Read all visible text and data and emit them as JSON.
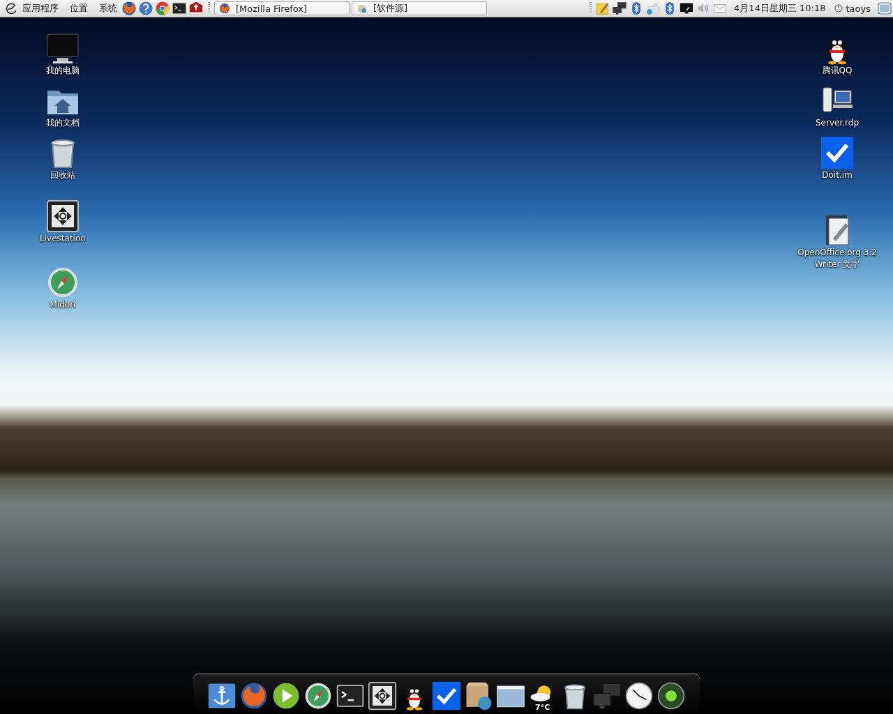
{
  "top_panel": {
    "menus": [
      "应用程序",
      "位置",
      "系统"
    ],
    "launchers": [
      {
        "kind": "firefox"
      },
      {
        "kind": "help"
      },
      {
        "kind": "chrome"
      },
      {
        "kind": "terminal"
      },
      {
        "kind": "book"
      }
    ],
    "window_buttons": [
      {
        "title": "[Mozilla Firefox]",
        "kind": "firefox"
      },
      {
        "title": "[软件源]",
        "kind": "software"
      }
    ],
    "tray": [
      {
        "kind": "notes"
      },
      {
        "kind": "network"
      },
      {
        "kind": "bluetooth"
      },
      {
        "kind": "keyboard"
      },
      {
        "kind": "bluetooth"
      },
      {
        "kind": "monitor"
      },
      {
        "kind": "volume"
      },
      {
        "kind": "mail"
      }
    ],
    "clock": "4月14日星期三 10:18",
    "user": "taoys"
  },
  "desktop_left": [
    {
      "label": "我的电脑",
      "kind": "computer"
    },
    {
      "label": "我的文档",
      "kind": "home"
    },
    {
      "label": "回收站",
      "kind": "trash"
    },
    {
      "label": "Livestation",
      "kind": "move"
    },
    {
      "label": "Midori",
      "kind": "compass"
    }
  ],
  "desktop_right": [
    {
      "label": "腾讯QQ",
      "kind": "penguin"
    },
    {
      "label": "Server.rdp",
      "kind": "rdp"
    },
    {
      "label": "Doit.im",
      "kind": "check"
    },
    {
      "label": "OpenOffice.org 3.2 Writer 文字",
      "kind": "writer"
    }
  ],
  "dock": [
    {
      "kind": "anchor"
    },
    {
      "kind": "firefox"
    },
    {
      "kind": "play"
    },
    {
      "kind": "compass"
    },
    {
      "kind": "terminal"
    },
    {
      "kind": "move"
    },
    {
      "kind": "penguin"
    },
    {
      "kind": "check"
    },
    {
      "kind": "package"
    },
    {
      "kind": "window"
    },
    {
      "kind": "weather",
      "text": "7°C"
    },
    {
      "kind": "trash"
    },
    {
      "kind": "network"
    },
    {
      "kind": "clock"
    },
    {
      "kind": "orb"
    }
  ]
}
